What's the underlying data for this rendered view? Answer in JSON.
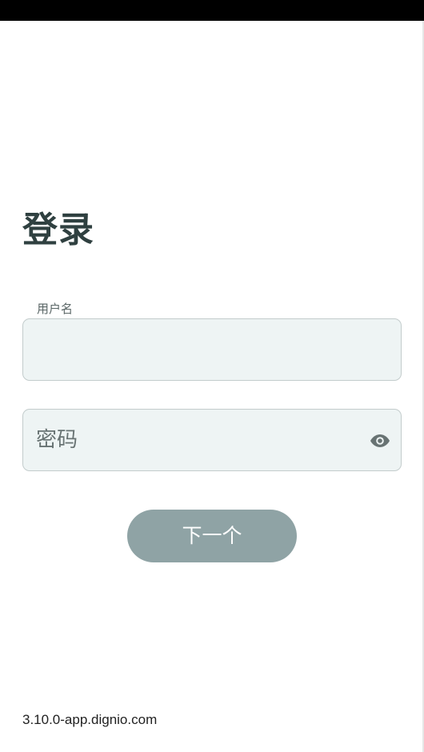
{
  "login": {
    "title": "登录",
    "username": {
      "label": "用户名",
      "value": ""
    },
    "password": {
      "placeholder": "密码",
      "value": "",
      "visibility_icon": "eye-icon"
    },
    "next_label": "下一个"
  },
  "footer": {
    "version": "3.10.0-app.dignio.com"
  },
  "colors": {
    "title": "#2f4040",
    "field_background": "#eef4f4",
    "field_border": "#c3cccc",
    "button_background": "#8fa3a5",
    "button_text": "#ffffff"
  }
}
